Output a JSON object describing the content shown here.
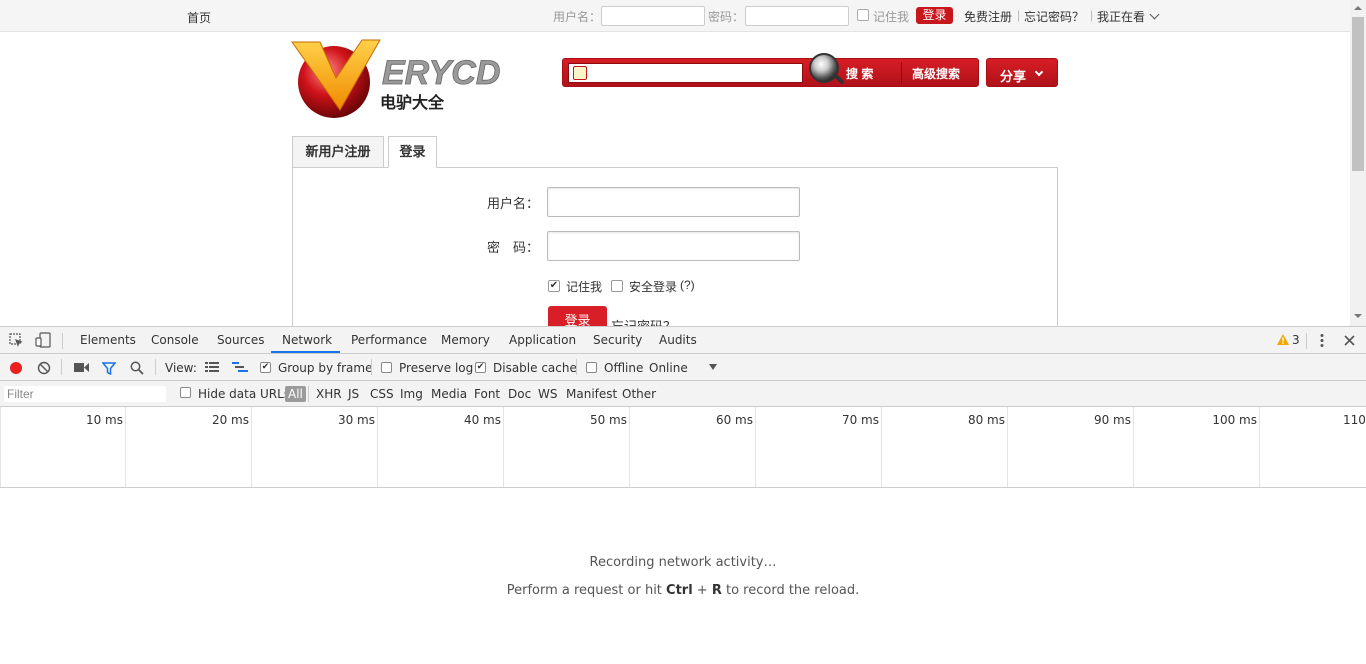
{
  "site": {
    "topbar": {
      "home": "首页",
      "username_label": "用户名：",
      "password_label": "密码：",
      "remember": "记住我",
      "login": "登录",
      "register": "免费注册",
      "forgot": "忘记密码？",
      "watching": "我正在看"
    },
    "logo": {
      "brand": "ERYCD",
      "subtitle": "电驴大全"
    },
    "search": {
      "search_btn": "搜 索",
      "advanced_btn": "高级搜索",
      "share_btn": "分享"
    },
    "tabs": [
      {
        "label": "新用户注册"
      },
      {
        "label": "登录"
      }
    ],
    "form": {
      "username_label": "用户名：",
      "password_label": "密　码：",
      "remember": "记住我",
      "secure_login": "安全登录",
      "help": "(?)",
      "submit": "登录",
      "forgot": "忘记密码？"
    }
  },
  "devtools": {
    "tabs": [
      "Elements",
      "Console",
      "Sources",
      "Network",
      "Performance",
      "Memory",
      "Application",
      "Security",
      "Audits"
    ],
    "active_tab": "Network",
    "warnings": "3",
    "toolbar": {
      "view": "View:",
      "group_by_frame": "Group by frame",
      "preserve_log": "Preserve log",
      "disable_cache": "Disable cache",
      "offline": "Offline",
      "throttle": "Online"
    },
    "filter": {
      "placeholder": "Filter",
      "hide_data_urls": "Hide data URLs",
      "types": [
        "All",
        "XHR",
        "JS",
        "CSS",
        "Img",
        "Media",
        "Font",
        "Doc",
        "WS",
        "Manifest",
        "Other"
      ]
    },
    "timeline_ticks": [
      "10 ms",
      "20 ms",
      "30 ms",
      "40 ms",
      "50 ms",
      "60 ms",
      "70 ms",
      "80 ms",
      "90 ms",
      "100 ms",
      "110"
    ],
    "empty": {
      "line1": "Recording network activity…",
      "line2_pre": "Perform a request or hit ",
      "key1": "Ctrl",
      "plus": " + ",
      "key2": "R",
      "line2_post": " to record the reload."
    }
  }
}
